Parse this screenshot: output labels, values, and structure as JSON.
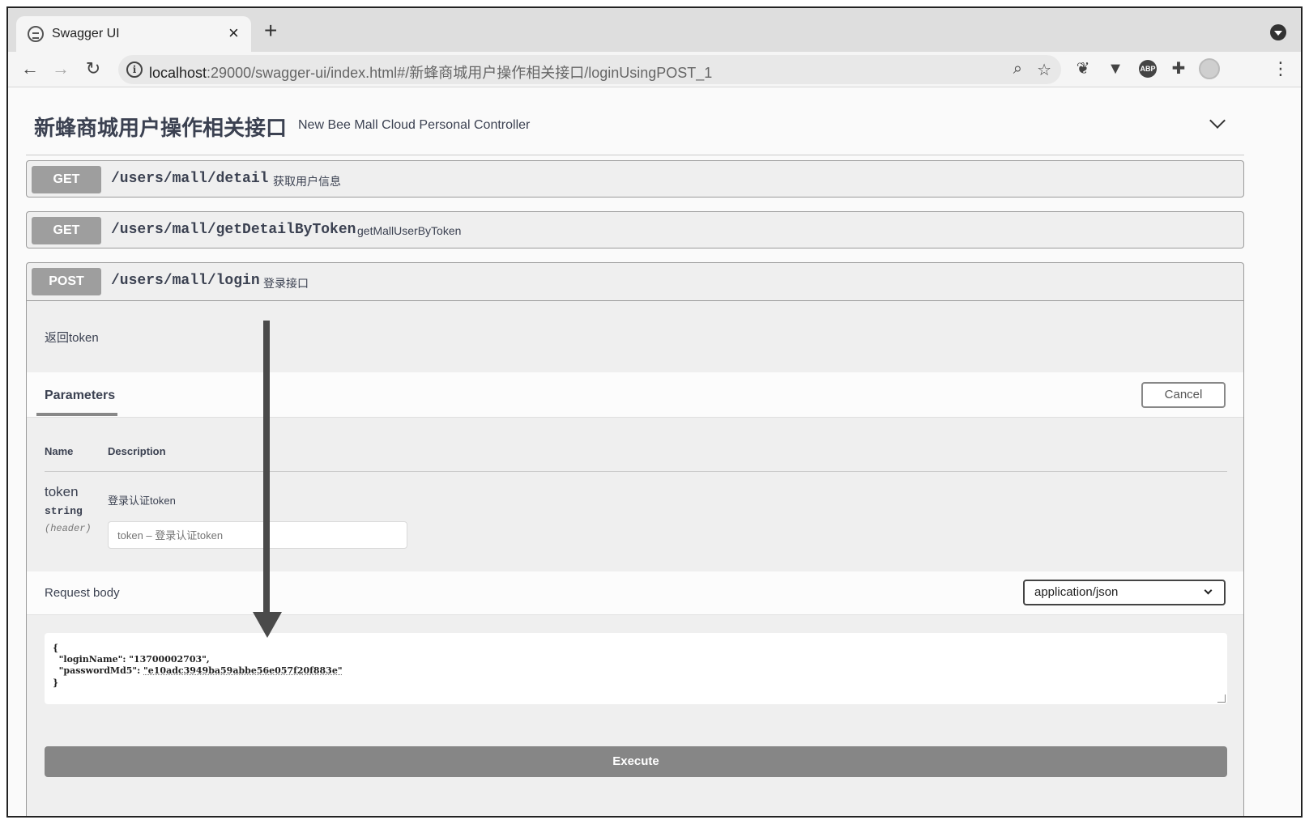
{
  "browser": {
    "tab_title": "Swagger UI",
    "tab_close": "×",
    "new_tab": "+",
    "url_host": "localhost",
    "url_rest": ":29000/swagger-ui/index.html#/新蜂商城用户操作相关接口/loginUsingPOST_1",
    "nav": {
      "back": "←",
      "forward": "→",
      "reload": "↻"
    },
    "omnibox_icons": [
      "zoom-icon",
      "star-icon"
    ],
    "extensions": [
      "evernote-icon",
      "vue-devtools-icon",
      "adblock-icon",
      "puzzle-icon",
      "profile-avatar"
    ],
    "adblock_label": "ABP",
    "menu": "⋮"
  },
  "section": {
    "title": "新蜂商城用户操作相关接口",
    "description": "New Bee Mall Cloud Personal Controller"
  },
  "operations": [
    {
      "method": "GET",
      "path": "/users/mall/detail",
      "summary": "获取用户信息"
    },
    {
      "method": "GET",
      "path": "/users/mall/getDetailByToken",
      "summary": "getMallUserByToken"
    },
    {
      "method": "POST",
      "path": "/users/mall/login",
      "summary": "登录接口"
    }
  ],
  "expanded": {
    "description": "返回token",
    "parameters_tab": "Parameters",
    "cancel_label": "Cancel",
    "columns": {
      "name": "Name",
      "description": "Description"
    },
    "param": {
      "name": "token",
      "type": "string",
      "in": "(header)",
      "description": "登录认证token",
      "placeholder": "token – 登录认证token"
    },
    "request_body_label": "Request body",
    "content_type": "application/json",
    "body_lines": [
      "{",
      "  \"loginName\": \"13700002703\",",
      "  \"passwordMd5\": ",
      "}"
    ],
    "password_value": "\"e10adc3949ba59abbe56e057f20f883e\"",
    "execute_label": "Execute"
  },
  "colors": {
    "method_badge": "#9e9e9e",
    "execute_button": "#868686",
    "annotation_arrow": "#4a4a4a"
  }
}
